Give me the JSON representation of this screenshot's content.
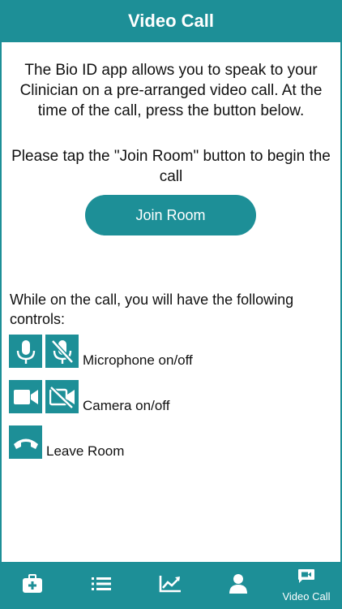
{
  "header": {
    "title": "Video Call"
  },
  "content": {
    "intro_text": "The Bio ID app allows you to speak to your Clinician on a pre-arranged video call. At the time of the call, press the button below.",
    "instruction_text": "Please tap the \"Join Room\" button to begin the call",
    "join_button_label": "Join Room",
    "controls_intro": "While on the call, you will have the following controls:",
    "controls": [
      {
        "label": "Microphone on/off",
        "icons": [
          "microphone-icon",
          "microphone-off-icon"
        ]
      },
      {
        "label": "Camera on/off",
        "icons": [
          "video-camera-icon",
          "video-camera-off-icon"
        ]
      },
      {
        "label": "Leave Room",
        "icons": [
          "hang-up-phone-icon"
        ]
      }
    ]
  },
  "tabbar": {
    "tabs": [
      {
        "icon": "medical-kit-icon",
        "label": ""
      },
      {
        "icon": "list-icon",
        "label": ""
      },
      {
        "icon": "chart-icon",
        "label": ""
      },
      {
        "icon": "person-icon",
        "label": ""
      },
      {
        "icon": "video-chat-icon",
        "label": "Video Call"
      }
    ]
  },
  "colors": {
    "accent": "#1d8f97",
    "text": "#111111",
    "background": "#ffffff"
  }
}
